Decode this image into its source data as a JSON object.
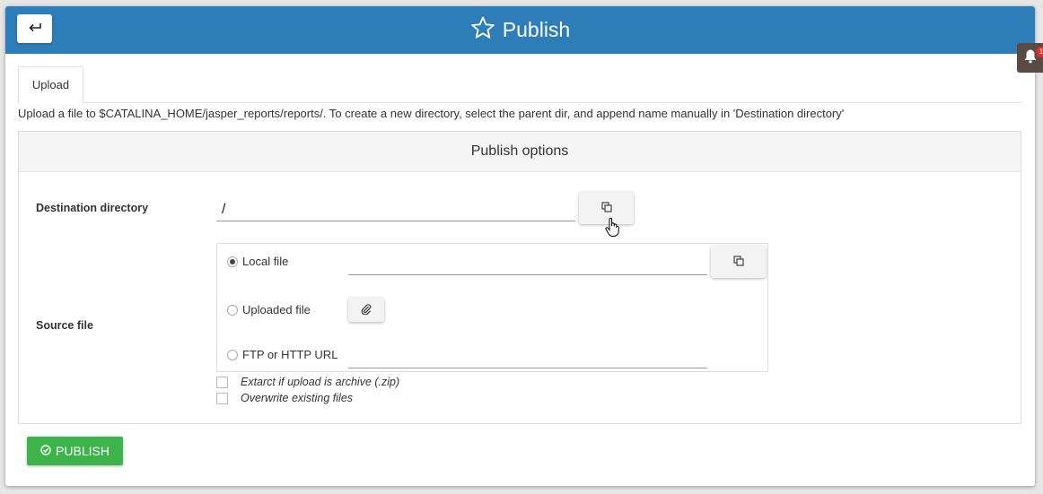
{
  "header": {
    "title": "Publish",
    "back_icon": "return-arrow-icon",
    "title_icon": "star-outline-icon",
    "color": "#2d7db8"
  },
  "tabs": [
    {
      "label": "Upload",
      "active": true
    }
  ],
  "help_text": "Upload a file to $CATALINA_HOME/jasper_reports/reports/. To create a new directory, select the parent dir, and append name manually in 'Destination directory'",
  "panel": {
    "title": "Publish options",
    "destination": {
      "label": "Destination directory",
      "value": "/",
      "browse_icon": "copy-icon"
    },
    "source": {
      "label": "Source file",
      "options": [
        {
          "label": "Local file",
          "checked": true,
          "value": ""
        },
        {
          "label": "Uploaded file",
          "checked": false
        },
        {
          "label": "FTP or HTTP URL",
          "checked": false,
          "value": ""
        }
      ],
      "local_browse_icon": "copy-icon",
      "upload_icon": "paperclip-icon"
    },
    "checkboxes": [
      {
        "label": "Extarct if upload is archive (.zip)",
        "checked": false
      },
      {
        "label": "Overwrite existing files",
        "checked": false
      }
    ]
  },
  "publish_button": {
    "label": "PUBLISH",
    "icon": "check-circle-icon",
    "color": "#3cb44a"
  },
  "notifications": {
    "count": "1",
    "icon": "bell-icon"
  }
}
